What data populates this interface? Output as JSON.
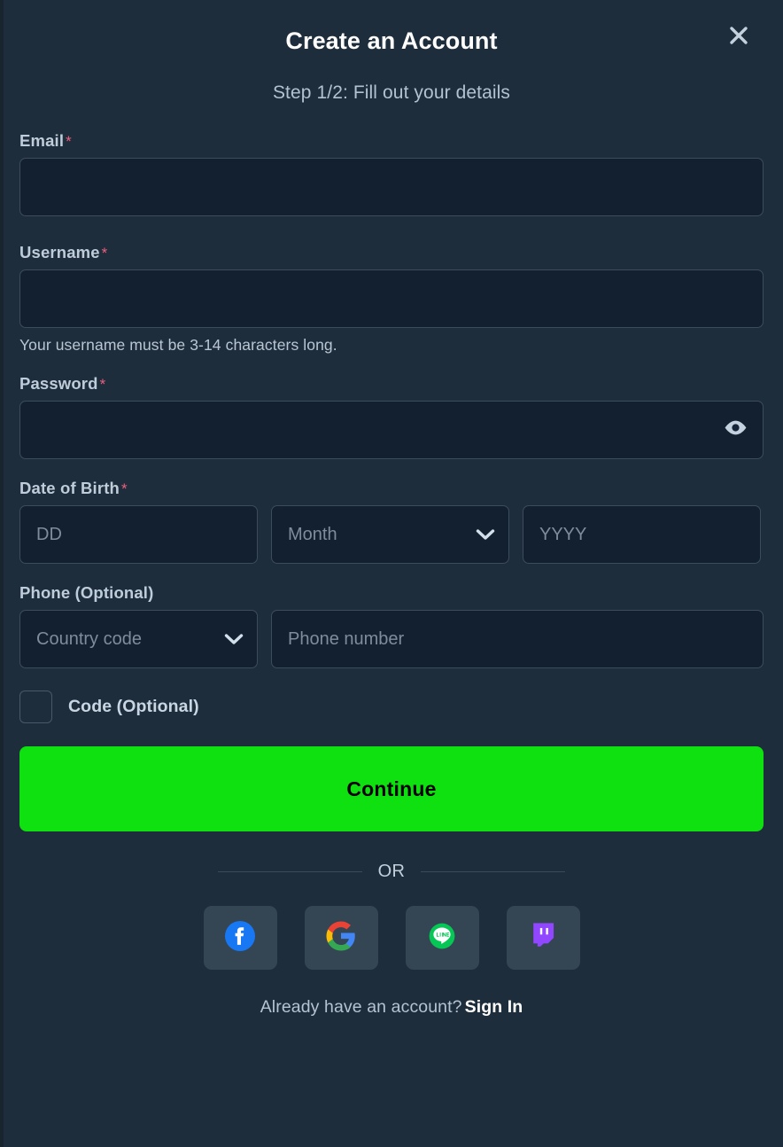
{
  "modal": {
    "title": "Create an Account",
    "close_icon": "close-icon",
    "step_text": "Step 1/2: Fill out your details"
  },
  "theme": {
    "background": "#1e2d3b",
    "input_background": "#122030",
    "input_border": "#3d4c5c",
    "label_color": "#bfccda",
    "required_color": "#ef5e7e",
    "accent_green": "#0fe00f",
    "social_tile": "#344553",
    "white": "#ffffff"
  },
  "form": {
    "email": {
      "label": "Email",
      "required_marker": "*",
      "value": "",
      "placeholder": ""
    },
    "username": {
      "label": "Username",
      "required_marker": "*",
      "value": "",
      "placeholder": "",
      "helper": "Your username must be 3-14 characters long."
    },
    "password": {
      "label": "Password",
      "required_marker": "*",
      "value": "",
      "placeholder": "",
      "toggle_icon": "eye-icon"
    },
    "date_of_birth": {
      "label": "Date of Birth",
      "required_marker": "*",
      "day": {
        "placeholder": "DD",
        "value": ""
      },
      "month": {
        "placeholder": "Month",
        "value": "",
        "chevron_icon": "chevron-down-icon"
      },
      "year": {
        "placeholder": "YYYY",
        "value": ""
      }
    },
    "phone": {
      "label": "Phone (Optional)",
      "country_code": {
        "placeholder": "Country code",
        "value": "",
        "chevron_icon": "chevron-down-icon"
      },
      "number": {
        "placeholder": "Phone number",
        "value": ""
      }
    },
    "code": {
      "label": "Code (Optional)",
      "checked": false
    },
    "submit_label": "Continue"
  },
  "divider": {
    "text": "OR"
  },
  "social": {
    "buttons": [
      {
        "name": "facebook",
        "label": "Facebook",
        "icon": "facebook-icon",
        "color": "#1877f2"
      },
      {
        "name": "google",
        "label": "Google",
        "icon": "google-icon",
        "color": "#4285f4"
      },
      {
        "name": "line",
        "label": "LINE",
        "icon": "line-icon",
        "color": "#06c755"
      },
      {
        "name": "twitch",
        "label": "Twitch",
        "icon": "twitch-icon",
        "color": "#9146ff"
      }
    ]
  },
  "footer": {
    "prompt": "Already have an account?",
    "signin_label": "Sign In"
  }
}
